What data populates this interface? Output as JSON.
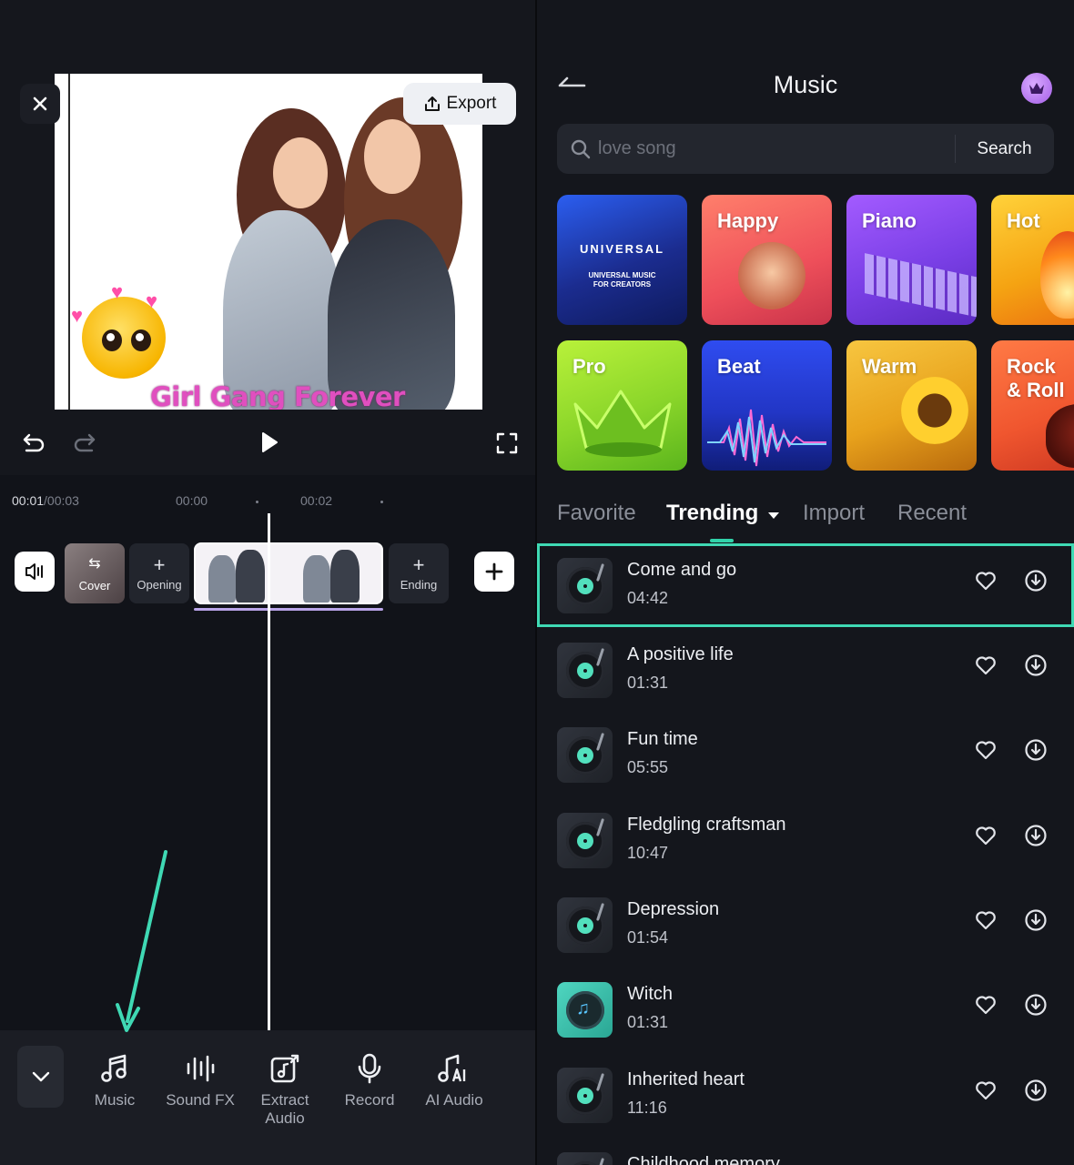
{
  "editor": {
    "export_label": "Export",
    "caption_text": "Girl Gang Forever",
    "timecode_current": "00:01",
    "timecode_total": "/00:03",
    "ruler_ticks": [
      "00:00",
      "00:02"
    ],
    "cover_label": "Cover",
    "opening_label": "Opening",
    "ending_label": "Ending",
    "add_symbol": "+",
    "tools": [
      {
        "label": "Music",
        "icon": "music-note-icon"
      },
      {
        "label": "Sound FX",
        "icon": "sound-waves-icon"
      },
      {
        "label": "Extract\nAudio",
        "icon": "extract-audio-icon"
      },
      {
        "label": "Record",
        "icon": "microphone-icon"
      },
      {
        "label": "AI Audio",
        "icon": "ai-music-icon"
      }
    ]
  },
  "music": {
    "title": "Music",
    "search_placeholder": "love song",
    "search_button": "Search",
    "categories": [
      {
        "label": "",
        "brand_title": "UNIVERSAL",
        "brand_sub": "UNIVERSAL MUSIC\nFOR CREATORS",
        "color": "#1f3fb5"
      },
      {
        "label": "Happy",
        "color": "#f0655f"
      },
      {
        "label": "Piano",
        "color": "#8b4df0"
      },
      {
        "label": "Hot",
        "color": "#f5a312"
      },
      {
        "label": "Pro",
        "color": "#8bd62a"
      },
      {
        "label": "Beat",
        "color": "#2a46d8"
      },
      {
        "label": "Warm",
        "color": "#e8a21c"
      },
      {
        "label": "Rock\n& Roll",
        "color": "#f0562f"
      }
    ],
    "tabs": [
      "Favorite",
      "Trending",
      "Import",
      "Recent"
    ],
    "active_tab": "Trending",
    "tracks": [
      {
        "name": "Come and go",
        "duration": "04:42"
      },
      {
        "name": "A positive life",
        "duration": "01:31"
      },
      {
        "name": "Fun time",
        "duration": "05:55"
      },
      {
        "name": "Fledgling craftsman",
        "duration": "10:47"
      },
      {
        "name": "Depression",
        "duration": "01:54"
      },
      {
        "name": "Witch",
        "duration": "01:31"
      },
      {
        "name": "Inherited heart",
        "duration": "11:16"
      },
      {
        "name": "Childhood memory",
        "duration": ""
      }
    ]
  },
  "colors": {
    "accent": "#3fd9b4",
    "annotation_arrow": "#3fd9b4",
    "clip_underline": "#b9a4e8"
  }
}
